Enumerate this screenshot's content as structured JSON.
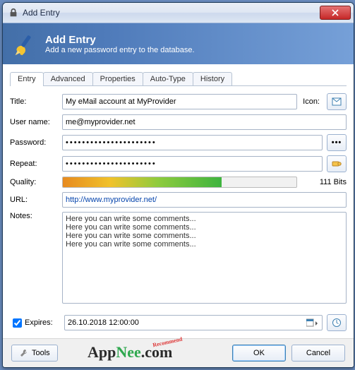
{
  "titlebar": {
    "text": "Add Entry"
  },
  "header": {
    "title": "Add Entry",
    "subtitle": "Add a new password entry to the database."
  },
  "tabs": [
    "Entry",
    "Advanced",
    "Properties",
    "Auto-Type",
    "History"
  ],
  "labels": {
    "title": "Title:",
    "icon": "Icon:",
    "username": "User name:",
    "password": "Password:",
    "repeat": "Repeat:",
    "quality": "Quality:",
    "url": "URL:",
    "notes": "Notes:",
    "expires": "Expires:"
  },
  "fields": {
    "title": "My eMail account at MyProvider",
    "username": "me@myprovider.net",
    "password": "••••••••••••••••••••••",
    "repeat": "••••••••••••••••••••••",
    "quality_bits": "111 Bits",
    "url": "http://www.myprovider.net/",
    "notes": "Here you can write some comments...\nHere you can write some comments...\nHere you can write some comments...\nHere you can write some comments...",
    "expires": "26.10.2018 12:00:00",
    "expires_checked": true
  },
  "footer": {
    "tools": "Tools",
    "ok": "OK",
    "cancel": "Cancel"
  },
  "watermark": {
    "a": "App",
    "b": "Nee",
    "c": ".com",
    "rec": "Recommend"
  }
}
